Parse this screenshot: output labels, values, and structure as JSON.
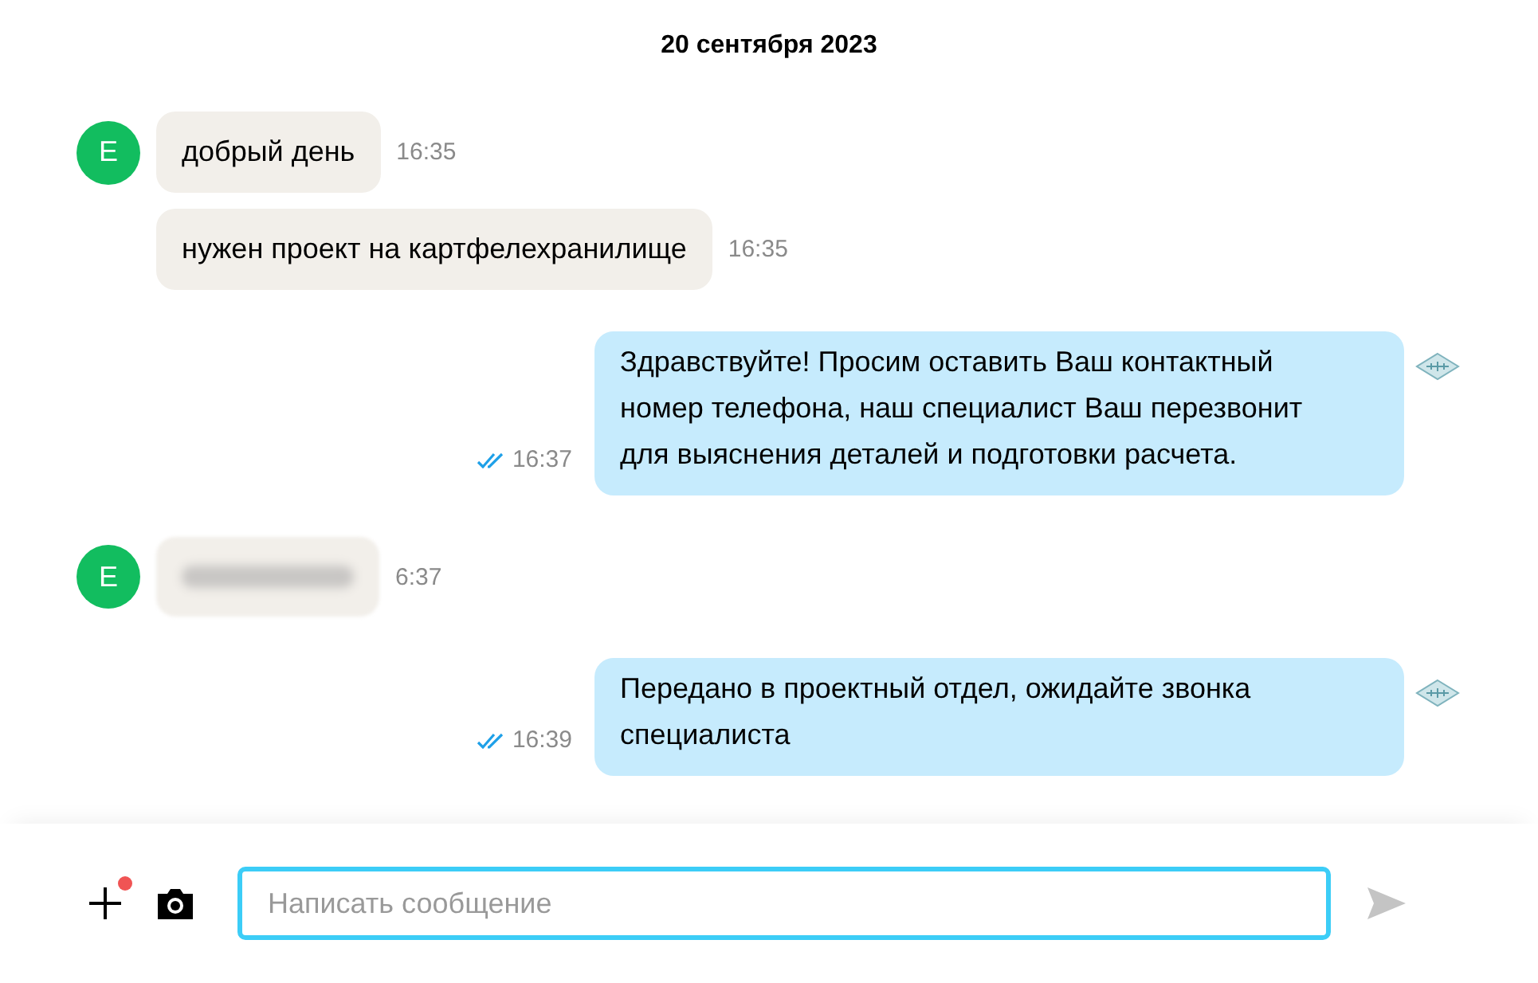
{
  "date": "20 сентября 2023",
  "messages": [
    {
      "outgoing": false,
      "kind": "text",
      "avatar": "E",
      "text": "добрый день",
      "time": "16:35"
    },
    {
      "outgoing": false,
      "kind": "text",
      "text": "нужен проект на картфелехранилище",
      "time": "16:35"
    },
    {
      "outgoing": true,
      "kind": "text",
      "text": "Здравствуйте! Просим оставить Ваш контактный номер телефона, наш специалист Ваш перезвонит для выяснения деталей и подготовки расчета.",
      "time": "16:37",
      "read": true
    },
    {
      "outgoing": false,
      "kind": "blurred",
      "avatar": "E",
      "time": "6:37"
    },
    {
      "outgoing": true,
      "kind": "text",
      "text": "Передано в проектный отдел, ожидайте звонка специалиста",
      "time": "16:39",
      "read": true
    }
  ],
  "composer": {
    "placeholder": "Написать сообщение",
    "attach_badge": true
  }
}
